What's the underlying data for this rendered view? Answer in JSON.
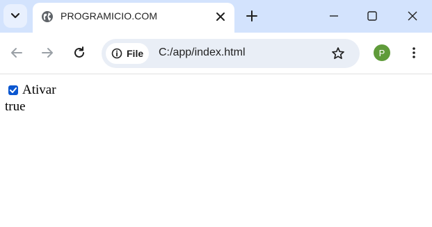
{
  "browser": {
    "tab": {
      "title": "PROGRAMICIO.COM"
    },
    "address_bar": {
      "chip_label": "File",
      "url": "C:/app/index.html"
    },
    "profile_initial": "P"
  },
  "page": {
    "checkbox": {
      "label": "Ativar",
      "checked": true
    },
    "output_text": "true"
  },
  "colors": {
    "tab_strip": "#d3e3fd",
    "omnibox": "#e9eef6",
    "checkbox_accent": "#0b57d0",
    "avatar": "#5f9b3a"
  },
  "icons": [
    "chevron-down-icon",
    "globe-icon",
    "close-icon",
    "plus-icon",
    "minimize-icon",
    "maximize-icon",
    "window-close-icon",
    "back-arrow-icon",
    "forward-arrow-icon",
    "reload-icon",
    "info-icon",
    "star-icon",
    "kebab-menu-icon"
  ]
}
